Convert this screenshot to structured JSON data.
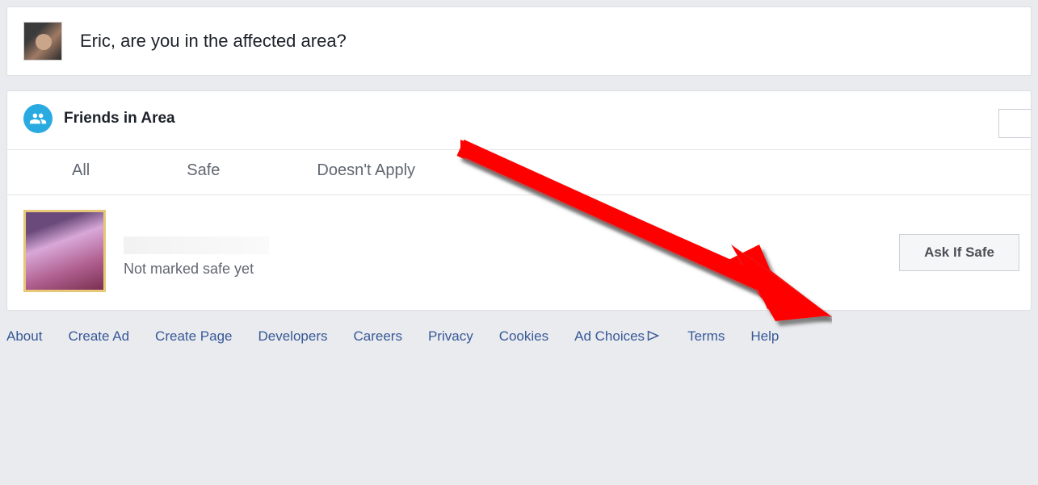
{
  "prompt": {
    "text": "Eric, are you in the affected area?"
  },
  "friends_section": {
    "title": "Friends in Area",
    "tabs": {
      "all": "All",
      "safe": "Safe",
      "doesnt_apply": "Doesn't Apply"
    },
    "friend": {
      "status": "Not marked safe yet",
      "ask_button": "Ask If Safe"
    }
  },
  "footer": {
    "about": "About",
    "create_ad": "Create Ad",
    "create_page": "Create Page",
    "developers": "Developers",
    "careers": "Careers",
    "privacy": "Privacy",
    "cookies": "Cookies",
    "ad_choices": "Ad Choices",
    "terms": "Terms",
    "help": "Help"
  }
}
